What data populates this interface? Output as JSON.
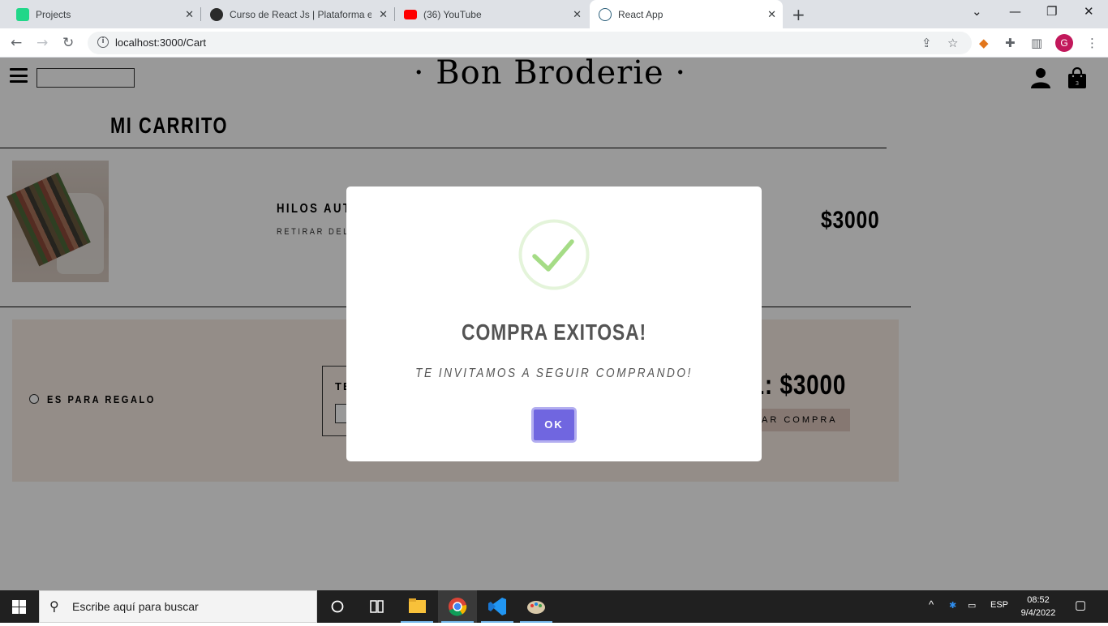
{
  "browser": {
    "tabs": [
      {
        "title": "Projects",
        "favicon_color": "#21d789"
      },
      {
        "title": "Curso de React Js | Plataforma eL",
        "favicon_color": "#2b2b2b"
      },
      {
        "title": "(36) YouTube",
        "favicon_color": "#ff0000"
      },
      {
        "title": "React App",
        "favicon_color": "#61dafb"
      }
    ],
    "active_tab": 3,
    "url": "localhost:3000/Cart",
    "profile_initial": "G"
  },
  "page": {
    "logo": "· Bon Broderie ·",
    "cart_badge": "3",
    "cart_title": "MI CARRITO",
    "item": {
      "name": "HILOS AUT",
      "remove_label": "RETIRAR DEL",
      "price": "$3000"
    },
    "summary": {
      "gift_label": "ES PARA REGALO",
      "message_label": "TE",
      "total_label": "L: $3000",
      "finalize_label": "AR COMPRA"
    }
  },
  "modal": {
    "title": "COMPRA EXITOSA!",
    "text": "TE INVITAMOS A SEGUIR COMPRANDO!",
    "ok_label": "OK",
    "success_color": "#a5dc86",
    "button_color": "#7066e0"
  },
  "taskbar": {
    "search_placeholder": "Escribe aquí para buscar",
    "language": "ESP",
    "time": "08:52",
    "date": "9/4/2022"
  }
}
